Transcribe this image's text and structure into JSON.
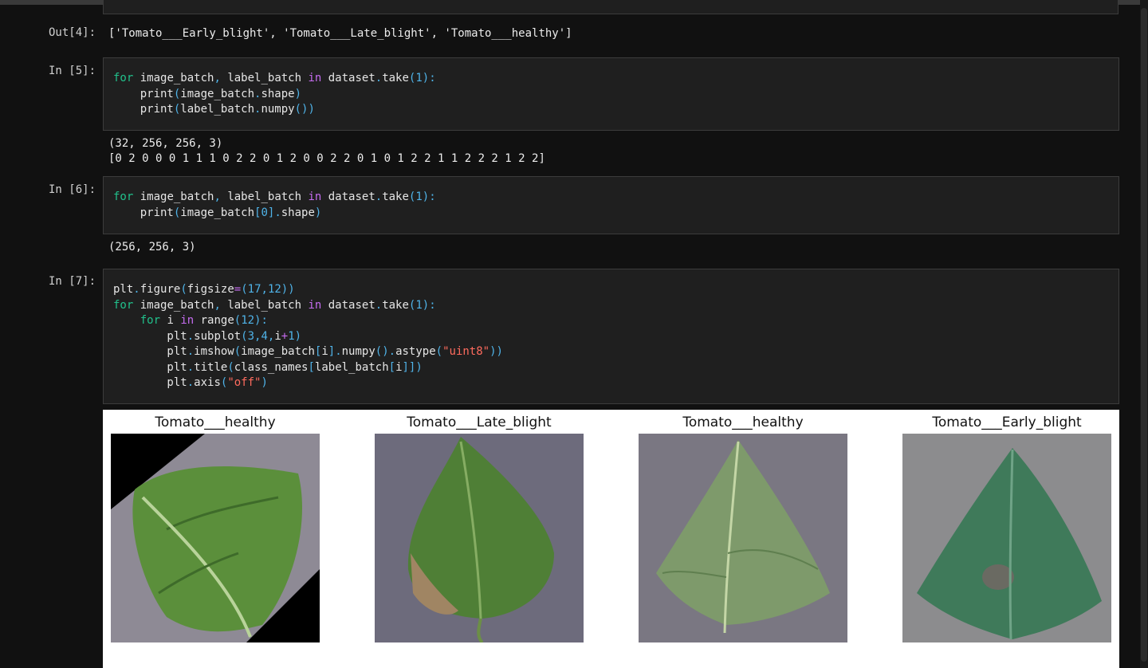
{
  "out4": {
    "prompt": "Out[4]:",
    "text": "['Tomato___Early_blight', 'Tomato___Late_blight', 'Tomato___healthy']"
  },
  "cell5": {
    "prompt": "In [5]:",
    "lines": [
      "for image_batch, label_batch in dataset.take(1):",
      "    print(image_batch.shape)",
      "    print(label_batch.numpy())"
    ],
    "output": [
      "(32, 256, 256, 3)",
      "[0 2 0 0 0 1 1 1 0 2 2 0 1 2 0 0 2 2 0 1 0 1 2 2 1 1 2 2 2 1 2 2]"
    ]
  },
  "cell6": {
    "prompt": "In [6]:",
    "lines": [
      "for image_batch, label_batch in dataset.take(1):",
      "    print(image_batch[0].shape)"
    ],
    "output": [
      "(256, 256, 3)"
    ]
  },
  "cell7": {
    "prompt": "In [7]:",
    "lines": [
      "plt.figure(figsize=(17,12))",
      "for image_batch, label_batch in dataset.take(1):",
      "    for i in range(12):",
      "        plt.subplot(3,4,i+1)",
      "        plt.imshow(image_batch[i].numpy().astype(\"uint8\"))",
      "        plt.title(class_names[label_batch[i]])",
      "        plt.axis(\"off\")"
    ]
  },
  "figure": {
    "subplots": [
      {
        "title": "Tomato___healthy",
        "image": "tomato-leaf-healthy-rotated-photo"
      },
      {
        "title": "Tomato___Late_blight",
        "image": "tomato-leaf-late-blight-photo"
      },
      {
        "title": "Tomato___healthy",
        "image": "tomato-leaf-healthy-photo"
      },
      {
        "title": "Tomato___Early_blight",
        "image": "tomato-leaf-early-blight-photo"
      }
    ]
  },
  "colors": {
    "background": "#111111",
    "cell": "#1f1f1f",
    "keyword": "#21c08b",
    "in_keyword": "#c56cf0",
    "number": "#4fb3e8",
    "string": "#ff6b5e"
  }
}
